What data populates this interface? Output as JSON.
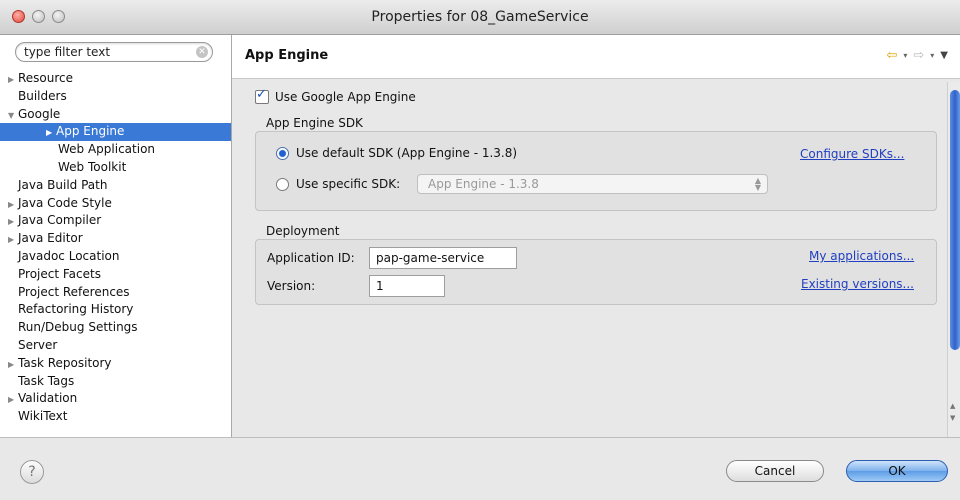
{
  "window": {
    "title": "Properties for 08_GameService"
  },
  "sidebar": {
    "filter_placeholder": "type filter text",
    "items": [
      {
        "label": "Resource",
        "arrow": "▶"
      },
      {
        "label": "Builders",
        "arrow": ""
      },
      {
        "label": "Google",
        "arrow": "▼"
      },
      {
        "label": "App Engine",
        "arrow": "▶"
      },
      {
        "label": "Web Application",
        "arrow": ""
      },
      {
        "label": "Web Toolkit",
        "arrow": ""
      },
      {
        "label": "Java Build Path",
        "arrow": ""
      },
      {
        "label": "Java Code Style",
        "arrow": "▶"
      },
      {
        "label": "Java Compiler",
        "arrow": "▶"
      },
      {
        "label": "Java Editor",
        "arrow": "▶"
      },
      {
        "label": "Javadoc Location",
        "arrow": ""
      },
      {
        "label": "Project Facets",
        "arrow": ""
      },
      {
        "label": "Project References",
        "arrow": ""
      },
      {
        "label": "Refactoring History",
        "arrow": ""
      },
      {
        "label": "Run/Debug Settings",
        "arrow": ""
      },
      {
        "label": "Server",
        "arrow": ""
      },
      {
        "label": "Task Repository",
        "arrow": "▶"
      },
      {
        "label": "Task Tags",
        "arrow": ""
      },
      {
        "label": "Validation",
        "arrow": "▶"
      },
      {
        "label": "WikiText",
        "arrow": ""
      }
    ]
  },
  "header": {
    "title": "App Engine",
    "back_icon": "⇦",
    "fwd_icon": "⇨",
    "dropdown_icon": "▾",
    "menu_icon": "▼"
  },
  "use_gae": {
    "label": "Use Google App Engine",
    "checked": true
  },
  "sdk": {
    "title": "App Engine SDK",
    "default_label": "Use default SDK (App Engine - 1.3.8)",
    "specific_label": "Use specific SDK:",
    "select_value": "App Engine - 1.3.8",
    "configure_link": "Configure SDKs..."
  },
  "deployment": {
    "title": "Deployment",
    "app_id_label": "Application ID:",
    "app_id_value": "pap-game-service",
    "version_label": "Version:",
    "version_value": "1",
    "my_apps_link": "My applications...",
    "versions_link": "Existing versions..."
  },
  "footer": {
    "help": "?",
    "cancel": "Cancel",
    "ok": "OK"
  },
  "colors": {
    "selection": "#3a79d6",
    "link": "#2140c0",
    "ok_button": "#5c9de6"
  }
}
